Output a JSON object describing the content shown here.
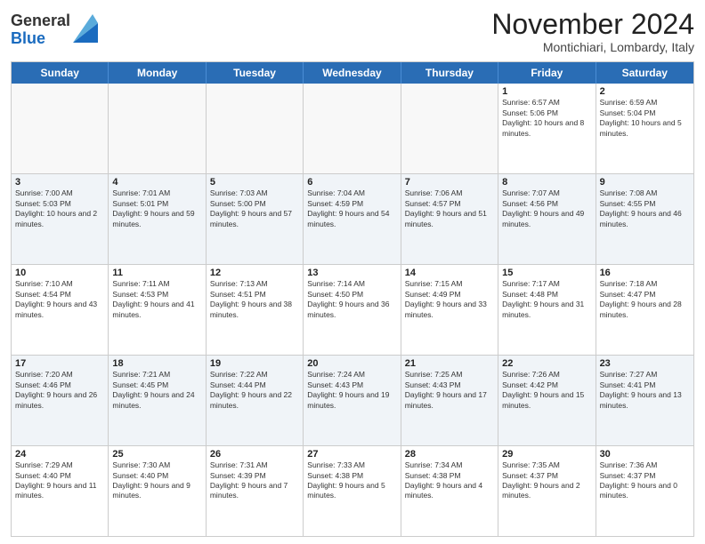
{
  "logo": {
    "line1": "General",
    "line2": "Blue"
  },
  "title": "November 2024",
  "location": "Montichiari, Lombardy, Italy",
  "days": [
    "Sunday",
    "Monday",
    "Tuesday",
    "Wednesday",
    "Thursday",
    "Friday",
    "Saturday"
  ],
  "rows": [
    [
      {
        "day": "",
        "info": ""
      },
      {
        "day": "",
        "info": ""
      },
      {
        "day": "",
        "info": ""
      },
      {
        "day": "",
        "info": ""
      },
      {
        "day": "",
        "info": ""
      },
      {
        "day": "1",
        "info": "Sunrise: 6:57 AM\nSunset: 5:06 PM\nDaylight: 10 hours and 8 minutes."
      },
      {
        "day": "2",
        "info": "Sunrise: 6:59 AM\nSunset: 5:04 PM\nDaylight: 10 hours and 5 minutes."
      }
    ],
    [
      {
        "day": "3",
        "info": "Sunrise: 7:00 AM\nSunset: 5:03 PM\nDaylight: 10 hours and 2 minutes."
      },
      {
        "day": "4",
        "info": "Sunrise: 7:01 AM\nSunset: 5:01 PM\nDaylight: 9 hours and 59 minutes."
      },
      {
        "day": "5",
        "info": "Sunrise: 7:03 AM\nSunset: 5:00 PM\nDaylight: 9 hours and 57 minutes."
      },
      {
        "day": "6",
        "info": "Sunrise: 7:04 AM\nSunset: 4:59 PM\nDaylight: 9 hours and 54 minutes."
      },
      {
        "day": "7",
        "info": "Sunrise: 7:06 AM\nSunset: 4:57 PM\nDaylight: 9 hours and 51 minutes."
      },
      {
        "day": "8",
        "info": "Sunrise: 7:07 AM\nSunset: 4:56 PM\nDaylight: 9 hours and 49 minutes."
      },
      {
        "day": "9",
        "info": "Sunrise: 7:08 AM\nSunset: 4:55 PM\nDaylight: 9 hours and 46 minutes."
      }
    ],
    [
      {
        "day": "10",
        "info": "Sunrise: 7:10 AM\nSunset: 4:54 PM\nDaylight: 9 hours and 43 minutes."
      },
      {
        "day": "11",
        "info": "Sunrise: 7:11 AM\nSunset: 4:53 PM\nDaylight: 9 hours and 41 minutes."
      },
      {
        "day": "12",
        "info": "Sunrise: 7:13 AM\nSunset: 4:51 PM\nDaylight: 9 hours and 38 minutes."
      },
      {
        "day": "13",
        "info": "Sunrise: 7:14 AM\nSunset: 4:50 PM\nDaylight: 9 hours and 36 minutes."
      },
      {
        "day": "14",
        "info": "Sunrise: 7:15 AM\nSunset: 4:49 PM\nDaylight: 9 hours and 33 minutes."
      },
      {
        "day": "15",
        "info": "Sunrise: 7:17 AM\nSunset: 4:48 PM\nDaylight: 9 hours and 31 minutes."
      },
      {
        "day": "16",
        "info": "Sunrise: 7:18 AM\nSunset: 4:47 PM\nDaylight: 9 hours and 28 minutes."
      }
    ],
    [
      {
        "day": "17",
        "info": "Sunrise: 7:20 AM\nSunset: 4:46 PM\nDaylight: 9 hours and 26 minutes."
      },
      {
        "day": "18",
        "info": "Sunrise: 7:21 AM\nSunset: 4:45 PM\nDaylight: 9 hours and 24 minutes."
      },
      {
        "day": "19",
        "info": "Sunrise: 7:22 AM\nSunset: 4:44 PM\nDaylight: 9 hours and 22 minutes."
      },
      {
        "day": "20",
        "info": "Sunrise: 7:24 AM\nSunset: 4:43 PM\nDaylight: 9 hours and 19 minutes."
      },
      {
        "day": "21",
        "info": "Sunrise: 7:25 AM\nSunset: 4:43 PM\nDaylight: 9 hours and 17 minutes."
      },
      {
        "day": "22",
        "info": "Sunrise: 7:26 AM\nSunset: 4:42 PM\nDaylight: 9 hours and 15 minutes."
      },
      {
        "day": "23",
        "info": "Sunrise: 7:27 AM\nSunset: 4:41 PM\nDaylight: 9 hours and 13 minutes."
      }
    ],
    [
      {
        "day": "24",
        "info": "Sunrise: 7:29 AM\nSunset: 4:40 PM\nDaylight: 9 hours and 11 minutes."
      },
      {
        "day": "25",
        "info": "Sunrise: 7:30 AM\nSunset: 4:40 PM\nDaylight: 9 hours and 9 minutes."
      },
      {
        "day": "26",
        "info": "Sunrise: 7:31 AM\nSunset: 4:39 PM\nDaylight: 9 hours and 7 minutes."
      },
      {
        "day": "27",
        "info": "Sunrise: 7:33 AM\nSunset: 4:38 PM\nDaylight: 9 hours and 5 minutes."
      },
      {
        "day": "28",
        "info": "Sunrise: 7:34 AM\nSunset: 4:38 PM\nDaylight: 9 hours and 4 minutes."
      },
      {
        "day": "29",
        "info": "Sunrise: 7:35 AM\nSunset: 4:37 PM\nDaylight: 9 hours and 2 minutes."
      },
      {
        "day": "30",
        "info": "Sunrise: 7:36 AM\nSunset: 4:37 PM\nDaylight: 9 hours and 0 minutes."
      }
    ]
  ]
}
